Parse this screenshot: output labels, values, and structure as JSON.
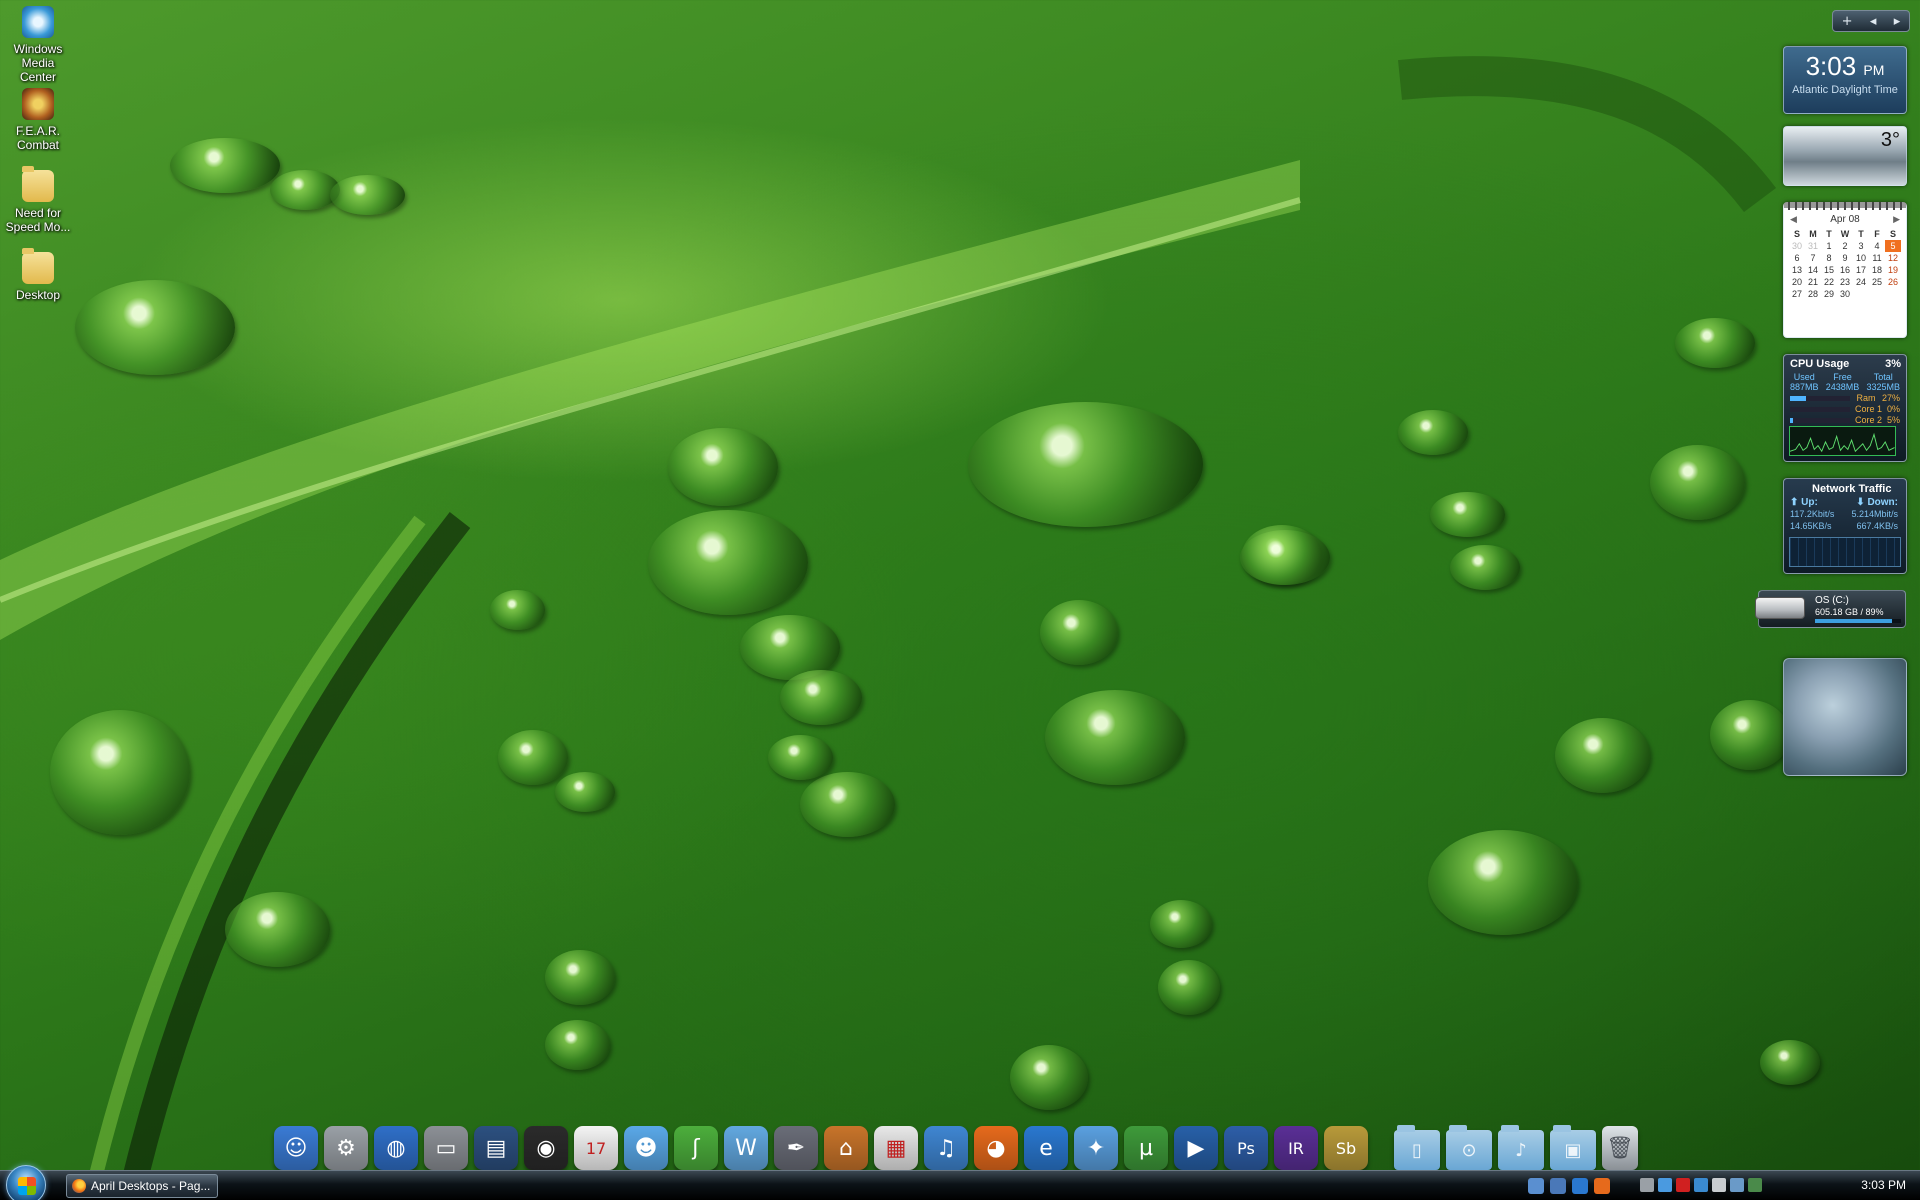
{
  "desktop_icons": [
    {
      "label": "Windows\nMedia Center",
      "icon": "windows-media-center-icon"
    },
    {
      "label": "F.E.A.R.\nCombat",
      "icon": "fear-combat-icon"
    },
    {
      "label": "Need for\nSpeed Mo...",
      "icon": "folder-icon"
    },
    {
      "label": "Desktop",
      "icon": "folder-icon"
    }
  ],
  "gadget_controls": {
    "add": "+",
    "prev": "◂",
    "next": "▸"
  },
  "clock": {
    "time": "3:03",
    "ampm": "PM",
    "timezone": "Atlantic Daylight Time"
  },
  "weather": {
    "temp": "3°"
  },
  "calendar": {
    "month": "Apr 08",
    "weekdays": [
      "S",
      "M",
      "T",
      "W",
      "T",
      "F",
      "S"
    ],
    "weeks": [
      [
        "30",
        "31",
        "1",
        "2",
        "3",
        "4",
        "5"
      ],
      [
        "6",
        "7",
        "8",
        "9",
        "10",
        "11",
        "12"
      ],
      [
        "13",
        "14",
        "15",
        "16",
        "17",
        "18",
        "19"
      ],
      [
        "20",
        "21",
        "22",
        "23",
        "24",
        "25",
        "26"
      ],
      [
        "27",
        "28",
        "29",
        "30",
        "",
        "",
        ""
      ]
    ],
    "today": "5"
  },
  "cpu": {
    "title": "CPU Usage",
    "percent": "3%",
    "columns": [
      {
        "label": "Used",
        "value": "887MB"
      },
      {
        "label": "Free",
        "value": "2438MB"
      },
      {
        "label": "Total",
        "value": "3325MB"
      }
    ],
    "rows": [
      {
        "label": "Ram",
        "value": "27%",
        "fill": 0.27
      },
      {
        "label": "Core 1",
        "value": "0%",
        "fill": 0.0
      },
      {
        "label": "Core 2",
        "value": "5%",
        "fill": 0.05
      }
    ]
  },
  "network": {
    "title": "Network Traffic",
    "up_label": "Up:",
    "down_label": "Down:",
    "up_rate": "117.2Kbit/s",
    "down_rate": "5.214Mbit/s",
    "up_bytes": "14.65KB/s",
    "down_bytes": "667.4KB/s"
  },
  "drive": {
    "name": "OS (C:)",
    "size": "605.18 GB / 89%",
    "fill": 0.89
  },
  "dock": {
    "apps": [
      {
        "name": "finder-icon",
        "color": "#3a7bd5",
        "glyph": "☺"
      },
      {
        "name": "system-preferences-icon",
        "color": "#9aa0a6",
        "glyph": "⚙"
      },
      {
        "name": "network-globe-icon",
        "color": "#2f6fc8",
        "glyph": "◍"
      },
      {
        "name": "hard-drive-icon",
        "color": "#8c9096",
        "glyph": "▭"
      },
      {
        "name": "media-strip-icon",
        "color": "#2c5080",
        "glyph": "▤"
      },
      {
        "name": "camera-lens-icon",
        "color": "#2b2b2b",
        "glyph": "◉"
      },
      {
        "name": "calendar-icon",
        "color": "#f4f4f4",
        "glyph": "17"
      },
      {
        "name": "messenger-icon",
        "color": "#5aa8e8",
        "glyph": "☻"
      },
      {
        "name": "dreamweaver-icon",
        "color": "#4cae3c",
        "glyph": "ʃ"
      },
      {
        "name": "word-icon",
        "color": "#62a8e0",
        "glyph": "W"
      },
      {
        "name": "pen-tool-icon",
        "color": "#6a6d78",
        "glyph": "✒"
      },
      {
        "name": "keynote-icon",
        "color": "#c8742a",
        "glyph": "⌂"
      },
      {
        "name": "chart-icon",
        "color": "#e8e8e8",
        "glyph": "▦"
      },
      {
        "name": "itunes-icon",
        "color": "#3f86d2",
        "glyph": "♫"
      },
      {
        "name": "firefox-icon",
        "color": "#e66a1c",
        "glyph": "◕"
      },
      {
        "name": "internet-explorer-icon",
        "color": "#2a78d0",
        "glyph": "e"
      },
      {
        "name": "safari-icon",
        "color": "#5aa0e0",
        "glyph": "✦"
      },
      {
        "name": "utorrent-icon",
        "color": "#3e9a3a",
        "glyph": "µ"
      },
      {
        "name": "media-player-icon",
        "color": "#2760a8",
        "glyph": "▶"
      },
      {
        "name": "photoshop-icon",
        "color": "#2d5ea8",
        "glyph": "Ps"
      },
      {
        "name": "illustrator-icon",
        "color": "#5a2f96",
        "glyph": "IR"
      },
      {
        "name": "soundbooth-icon",
        "color": "#b89a3a",
        "glyph": "Sb"
      }
    ],
    "stacks": [
      {
        "name": "documents-stack-icon",
        "glyph": "▯"
      },
      {
        "name": "downloads-stack-icon",
        "glyph": "⊙"
      },
      {
        "name": "music-stack-icon",
        "glyph": "♪"
      },
      {
        "name": "pictures-stack-icon",
        "glyph": "▣"
      }
    ],
    "trash": {
      "name": "trash-icon",
      "glyph": "🗑"
    }
  },
  "taskbar": {
    "window_title": "April Desktops - Pag...",
    "clock": "3:03 PM",
    "quick_launch": [
      "show-desktop-icon",
      "switch-windows-icon",
      "internet-explorer-icon",
      "firefox-icon"
    ],
    "tray": [
      "expand-icon",
      "network-icon",
      "antivirus-icon",
      "update-icon",
      "volume-icon",
      "pen-icon",
      "safely-remove-icon"
    ]
  }
}
